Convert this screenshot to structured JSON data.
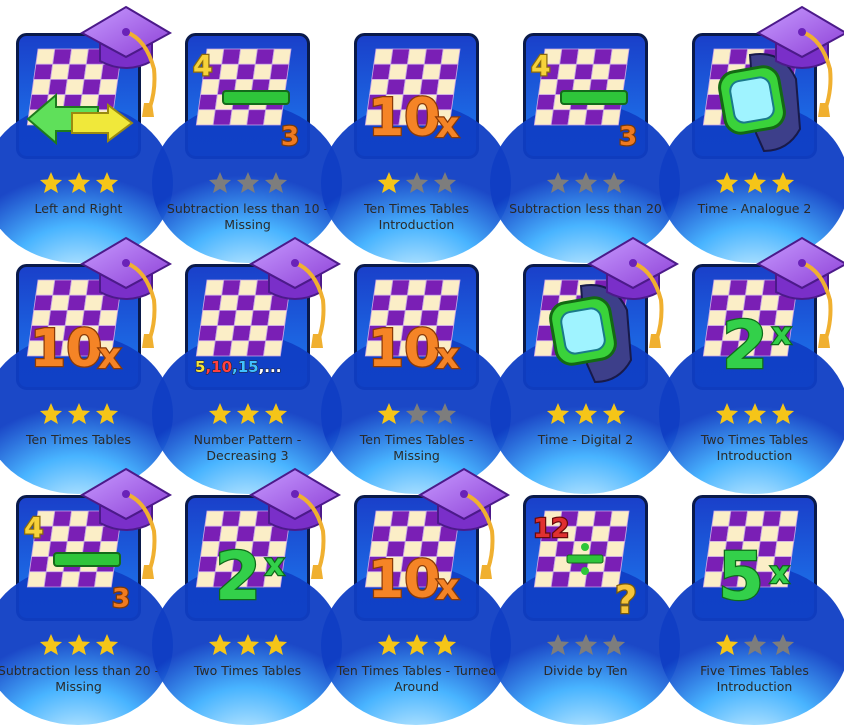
{
  "colors": {
    "star_gold": "#f5c518",
    "star_grey": "#7d7d7d",
    "tile_border": "#0a1a4a",
    "grid_purple": "#7a1fb5",
    "grid_cream": "#fbeec7",
    "cap_purple": "#8d3fd6",
    "tassel": "#f0b030"
  },
  "lessons": [
    {
      "label": "Left and Right",
      "stars": 3,
      "icon": "left-right-arrows-icon",
      "cap": true
    },
    {
      "label": "Subtraction less than 10 - Missing",
      "stars": 0,
      "icon": "subtraction-icon",
      "cap": false
    },
    {
      "label": "Ten Times Tables Introduction",
      "stars": 1,
      "icon": "ten-times-icon",
      "cap": false
    },
    {
      "label": "Subtraction less than 20",
      "stars": 0,
      "icon": "subtraction-icon",
      "cap": false
    },
    {
      "label": "Time - Analogue 2",
      "stars": 3,
      "icon": "watch-icon",
      "cap": true
    },
    {
      "label": "Ten Times Tables",
      "stars": 3,
      "icon": "ten-times-icon",
      "cap": true
    },
    {
      "label": "Number Pattern - Decreasing 3",
      "stars": 3,
      "icon": "number-pattern-icon",
      "cap": true
    },
    {
      "label": "Ten Times Tables - Missing",
      "stars": 1,
      "icon": "ten-times-icon",
      "cap": false
    },
    {
      "label": "Time - Digital 2",
      "stars": 3,
      "icon": "watch-icon",
      "cap": true
    },
    {
      "label": "Two Times Tables Introduction",
      "stars": 3,
      "icon": "two-times-icon",
      "cap": true
    },
    {
      "label": "Subtraction less than 20 - Missing",
      "stars": 3,
      "icon": "subtraction-icon",
      "cap": true
    },
    {
      "label": "Two Times Tables",
      "stars": 3,
      "icon": "two-times-icon",
      "cap": true
    },
    {
      "label": "Ten Times Tables - Turned Around",
      "stars": 3,
      "icon": "ten-times-icon",
      "cap": true
    },
    {
      "label": "Divide by Ten",
      "stars": 0,
      "icon": "divide-icon",
      "cap": false
    },
    {
      "label": "Five Times Tables Introduction",
      "stars": 1,
      "icon": "five-times-icon",
      "cap": false
    }
  ],
  "icon_text": {
    "ten": "10",
    "times": "x",
    "two": "2",
    "five": "5",
    "four": "4",
    "three": "3",
    "twelve": "12",
    "pattern": "5,10,15,...",
    "question": "?"
  }
}
